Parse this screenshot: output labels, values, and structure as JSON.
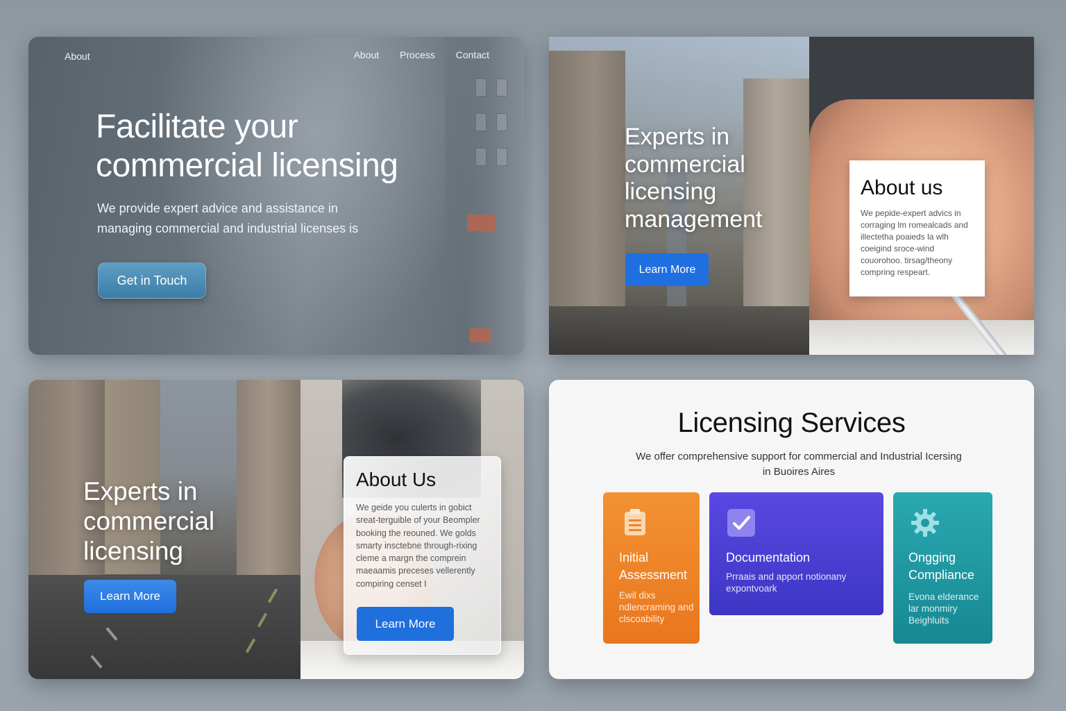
{
  "panel1": {
    "nav_left": "About",
    "nav": [
      "About",
      "Process",
      "Contact"
    ],
    "title": "Facilitate your commercial licensing",
    "subtitle": "We provide expert advice and assistance in managing commercial and industrial licenses is",
    "cta": "Get in Touch"
  },
  "panel2": {
    "title": "Experts in commercial licensing management",
    "cta": "Learn More",
    "about_title": "About us",
    "about_text": "We pepide-expert advics in corraging lm romealcads and illectetha poaieds la wlh coeigind sroce-wind couorohoo. tirsag/theony compring respeart."
  },
  "panel3": {
    "title": "Experts in commercial licensing",
    "cta": "Learn More",
    "about_title": "About Us",
    "about_text": "We geide you culerts in gobict sreat-terguible of your Beompler booking the reouned. We golds smarty insctebne through-rixing cleme a margn the comprein maeaamis preceses vellerently compiring censet I",
    "about_cta": "Learn More"
  },
  "panel4": {
    "title": "Licensing Services",
    "subtitle": "We offer comprehensive support for commercial and Industrial Icersing in Buoires Aires",
    "cards": [
      {
        "title": "Initial Assessment",
        "text": "Ewil dixs ndlencraming and clscoability",
        "icon": "clipboard-icon",
        "color": "#ef8527"
      },
      {
        "title": "Documentation",
        "text": "Prraais and apport notionany expontvoark",
        "icon": "check-square-icon",
        "color": "#4a3fd6"
      },
      {
        "title": "Ongging Compliance",
        "text": "Evona elderance lar monmiry Beighluits",
        "icon": "gear-icon",
        "color": "#1f98a2"
      }
    ]
  }
}
